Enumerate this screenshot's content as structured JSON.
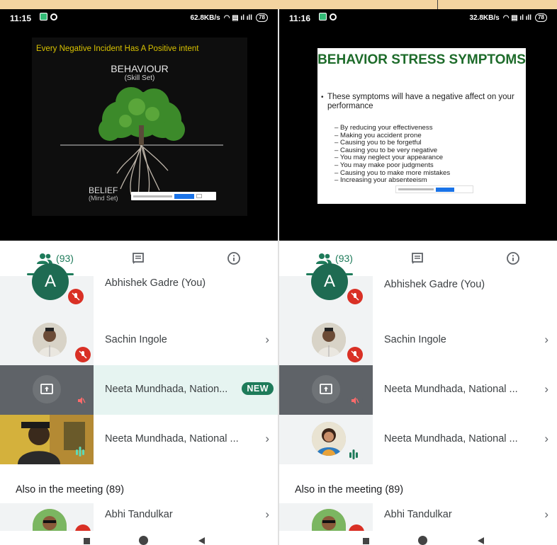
{
  "left": {
    "status": {
      "time": "11:15",
      "speed": "62.8KB/s",
      "battery": "78"
    },
    "slide": {
      "headline": "Every Negative Incident Has A Positive intent",
      "top_label": "BEHAVIOUR",
      "top_sub": "(Skill Set)",
      "bottom_label": "BELIEF",
      "bottom_sub": "(Mind Set)"
    },
    "tabs": {
      "people": "(93)"
    },
    "participants": [
      {
        "name": "Abhishek Gadre (You)",
        "avatar_letter": "A",
        "status": "muted"
      },
      {
        "name": "Sachin Ingole",
        "status": "muted"
      },
      {
        "name": "Neeta Mundhada, Nation...",
        "badge": "NEW",
        "status": "muted"
      },
      {
        "name": "Neeta Mundhada, National ...",
        "status": "speaking"
      }
    ],
    "section": "Also in the meeting (89)",
    "others": [
      {
        "name": "Abhi Tandulkar"
      }
    ]
  },
  "right": {
    "status": {
      "time": "11:16",
      "speed": "32.8KB/s",
      "battery": "78"
    },
    "slide": {
      "title": "BEHAVIOR STRESS SYMPTOMS",
      "bullet": "These symptoms will have a negative affect on your performance",
      "items": [
        "By reducing your effectiveness",
        "Making you accident prone",
        "Causing you to be forgetful",
        "Causing you to be very negative",
        "You may neglect your appearance",
        "You may make poor judgments",
        "Causing you to make more mistakes",
        "Increasing your absenteeism"
      ]
    },
    "tabs": {
      "people": "(93)"
    },
    "participants": [
      {
        "name": "Abhishek Gadre (You)",
        "avatar_letter": "A",
        "status": "muted"
      },
      {
        "name": "Sachin Ingole",
        "status": "muted"
      },
      {
        "name": "Neeta Mundhada, National ...",
        "status": "muted"
      },
      {
        "name": "Neeta Mundhada, National ...",
        "status": "speaking"
      }
    ],
    "section": "Also in the meeting (89)",
    "others": [
      {
        "name": "Abhi Tandulkar"
      }
    ]
  },
  "colors": {
    "accent": "#1e7b5a",
    "mute": "#d93025",
    "slide_title": "#1d6b2a"
  },
  "icons": [
    "people-icon",
    "chat-icon",
    "info-icon",
    "mic-off-icon",
    "present-screen-icon",
    "chevron-right-icon",
    "audio-level-icon"
  ]
}
